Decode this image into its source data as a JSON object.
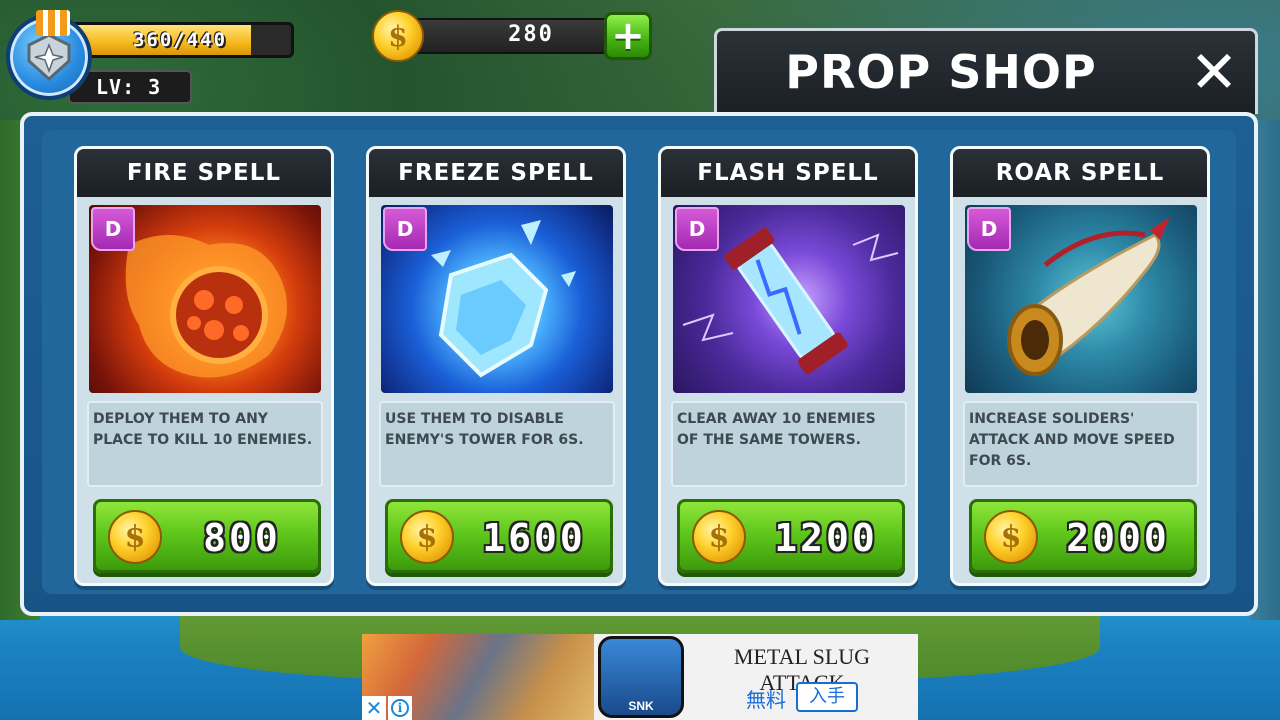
{
  "hud": {
    "hp_text": "360/440",
    "hp_current": 360,
    "hp_max": 440,
    "level_text": "LV: 3",
    "coins": "280",
    "add_coins_label": "+"
  },
  "shop": {
    "title": "PROP SHOP",
    "close_label": "✕",
    "coin_symbol": "$",
    "items": [
      {
        "name": "FIRE SPELL",
        "rank": "D",
        "description": "DEPLOY THEM TO ANY PLACE TO KILL 10 ENEMIES.",
        "price": "800",
        "icon": "fireball-icon"
      },
      {
        "name": "FREEZE SPELL",
        "rank": "D",
        "description": "USE THEM TO DISABLE ENEMY'S TOWER FOR 6S.",
        "price": "1600",
        "icon": "ice-crystal-icon"
      },
      {
        "name": "FLASH SPELL",
        "rank": "D",
        "description": "CLEAR AWAY 10 ENEMIES OF THE SAME TOWERS.",
        "price": "1200",
        "icon": "lightning-tube-icon"
      },
      {
        "name": "ROAR SPELL",
        "rank": "D",
        "description": "INCREASE SOLIDERS' ATTACK AND MOVE SPEED FOR 6S.",
        "price": "2000",
        "icon": "war-horn-icon"
      }
    ]
  },
  "ad": {
    "title": "METAL SLUG ATTACK",
    "free_label": "無料",
    "get_label": "入手",
    "icon_label": "SNK",
    "close_label": "✕",
    "info_label": "i"
  },
  "colors": {
    "panel_blue": "#1d5f94",
    "buy_green": "#5cc41a",
    "rank_purple": "#a329b2",
    "coin_gold": "#ffd22e",
    "hp_yellow": "#f5b81b"
  }
}
